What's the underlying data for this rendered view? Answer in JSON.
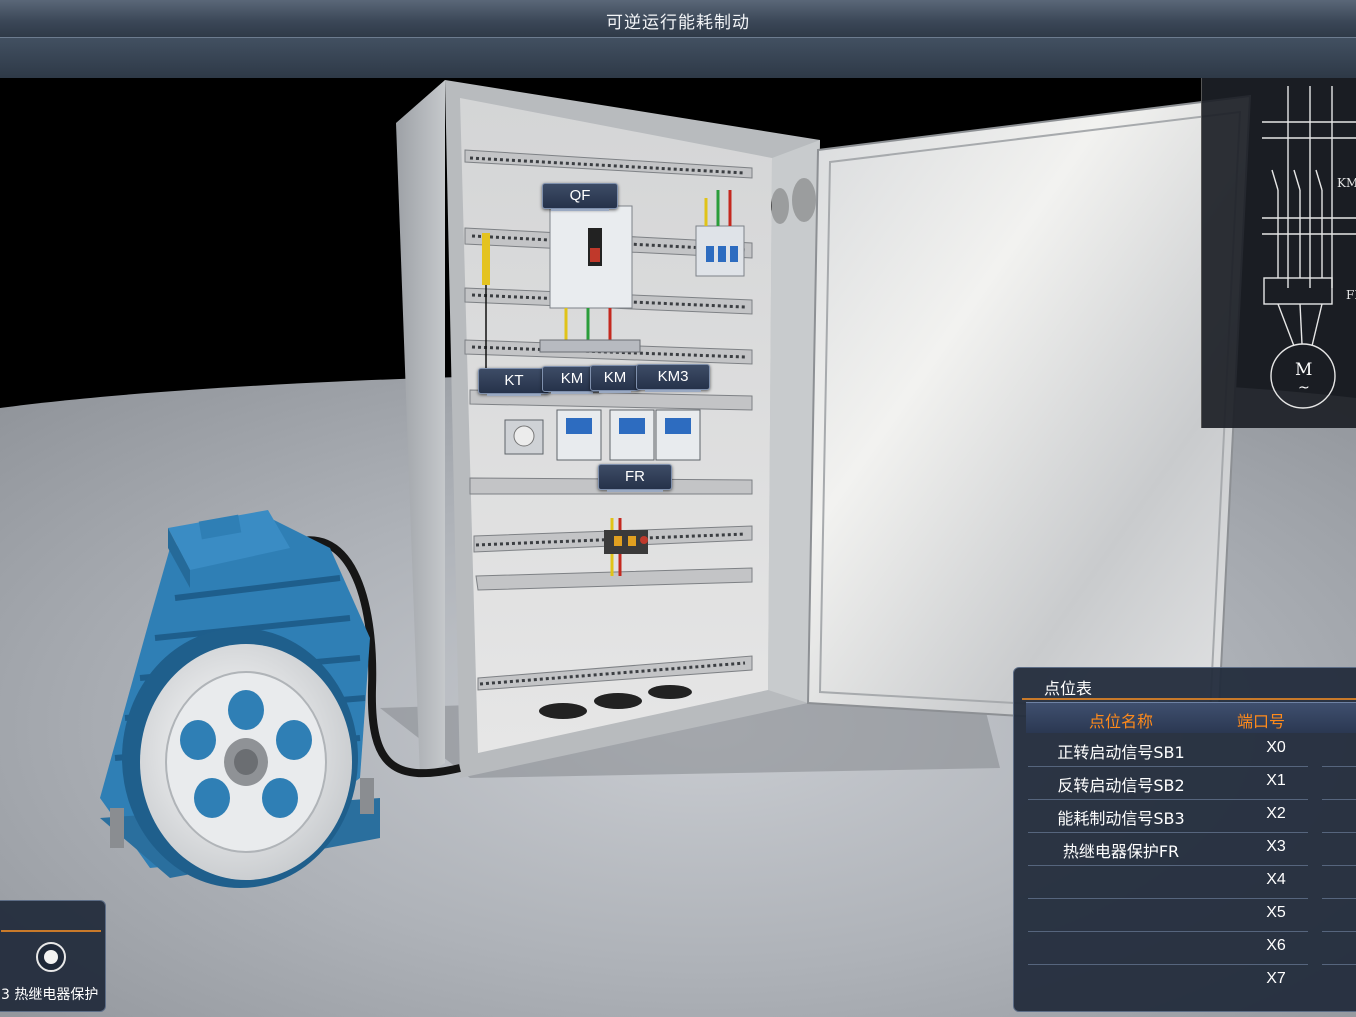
{
  "window": {
    "title": "可逆运行能耗制动"
  },
  "cabinet_tags": {
    "qf": "QF",
    "kt": "KT",
    "km1": "KM",
    "km2": "KM",
    "km3": "KM3",
    "fr": "FR"
  },
  "diagram": {
    "label_km": "KM",
    "label_fr": "FI",
    "motor_letter": "M",
    "motor_symbol": "~"
  },
  "point_table": {
    "title": "点位表",
    "headers": {
      "name": "点位名称",
      "port": "端口号"
    },
    "rows": [
      {
        "name": "正转启动信号SB1",
        "port": "X0"
      },
      {
        "name": "反转启动信号SB2",
        "port": "X1"
      },
      {
        "name": "能耗制动信号SB3",
        "port": "X2"
      },
      {
        "name": "热继电器保护FR",
        "port": "X3"
      },
      {
        "name": "",
        "port": "X4"
      },
      {
        "name": "",
        "port": "X5"
      },
      {
        "name": "",
        "port": "X6"
      },
      {
        "name": "",
        "port": "X7"
      }
    ]
  },
  "control_panel": {
    "radio_label": "3 热继电器保护"
  },
  "colors": {
    "accent": "#c97a2a",
    "header_text": "#ff8a1a",
    "panel_bg": "#222c3c",
    "motor_blue": "#2f7fb5"
  }
}
